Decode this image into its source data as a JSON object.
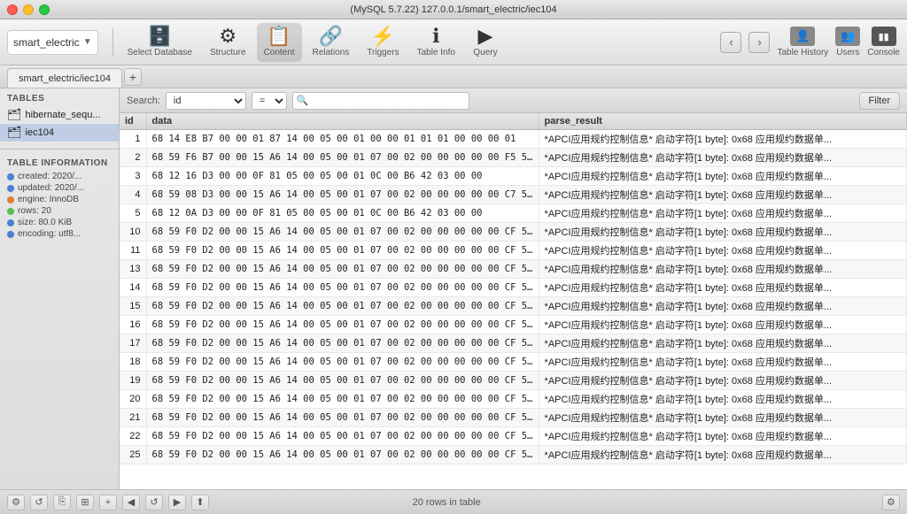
{
  "window": {
    "title": "(MySQL 5.7.22) 127.0.0.1/smart_electric/iec104"
  },
  "toolbar": {
    "db_selector": "smart_electric",
    "select_db_label": "Select Database",
    "structure_label": "Structure",
    "content_label": "Content",
    "relations_label": "Relations",
    "triggers_label": "Triggers",
    "tableinfo_label": "Table Info",
    "query_label": "Query",
    "table_history_label": "Table History",
    "users_label": "Users",
    "console_label": "Console"
  },
  "tabs": [
    {
      "label": "smart_electric/iec104",
      "active": true
    }
  ],
  "search": {
    "label": "Search:",
    "field_value": "id",
    "operator_value": "=",
    "placeholder": "",
    "filter_label": "Filter"
  },
  "sidebar": {
    "tables_title": "TABLES",
    "items": [
      {
        "label": "hibernate_sequ...",
        "active": false
      },
      {
        "label": "iec104",
        "active": true
      }
    ],
    "table_info_title": "TABLE INFORMATION",
    "info_rows": [
      {
        "label": "created: 2020/...",
        "color": "blue"
      },
      {
        "label": "updated: 2020/...",
        "color": "blue"
      },
      {
        "label": "engine: InnoDB",
        "color": "orange"
      },
      {
        "label": "rows: 20",
        "color": "green"
      },
      {
        "label": "size: 80.0 KiB",
        "color": "blue"
      },
      {
        "label": "encoding: utf8...",
        "color": "blue"
      }
    ]
  },
  "table": {
    "columns": [
      "id",
      "data",
      "parse_result"
    ],
    "rows": [
      {
        "id": "1",
        "data": "68 14 E8 B7 00 00 01 87 14 00 05 00 01 00 00 01 01 01 00 00 00 01",
        "parse_result": "*APCI应用规约控制信息* 启动字符[1 byte]: 0x68  应用规约数据单..."
      },
      {
        "id": "2",
        "data": "68 59 F6 B7 00 00 15 A6 14 00 05 00 01 07 00 02 00 00 00 00 00 F5 5C...",
        "parse_result": "*APCI应用规约控制信息* 启动字符[1 byte]: 0x68  应用规约数据单..."
      },
      {
        "id": "3",
        "data": "68 12 16 D3 00 00 0F 81 05 00 05 00 01 0C 00 B6 42 03 00 00",
        "parse_result": "*APCI应用规约控制信息* 启动字符[1 byte]: 0x68  应用规约数据单..."
      },
      {
        "id": "4",
        "data": "68 59 08 D3 00 00 15 A6 14 00 05 00 01 07 00 02 00 00 00 00 00 C7 5D...",
        "parse_result": "*APCI应用规约控制信息* 启动字符[1 byte]: 0x68  应用规约数据单..."
      },
      {
        "id": "5",
        "data": "68 12 0A D3 00 00 0F 81 05 00 05 00 01 0C 00 B6 42 03 00 00",
        "parse_result": "*APCI应用规约控制信息* 启动字符[1 byte]: 0x68  应用规约数据单..."
      },
      {
        "id": "10",
        "data": "68 59 F0 D2 00 00 15 A6 14 00 05 00 01 07 00 02 00 00 00 00 00 CF 5D...",
        "parse_result": "*APCI应用规约控制信息* 启动字符[1 byte]: 0x68  应用规约数据单..."
      },
      {
        "id": "11",
        "data": "68 59 F0 D2 00 00 15 A6 14 00 05 00 01 07 00 02 00 00 00 00 00 CF 5D...",
        "parse_result": "*APCI应用规约控制信息* 启动字符[1 byte]: 0x68  应用规约数据单..."
      },
      {
        "id": "13",
        "data": "68 59 F0 D2 00 00 15 A6 14 00 05 00 01 07 00 02 00 00 00 00 00 CF 5D...",
        "parse_result": "*APCI应用规约控制信息* 启动字符[1 byte]: 0x68  应用规约数据单..."
      },
      {
        "id": "14",
        "data": "68 59 F0 D2 00 00 15 A6 14 00 05 00 01 07 00 02 00 00 00 00 00 CF 5D...",
        "parse_result": "*APCI应用规约控制信息* 启动字符[1 byte]: 0x68  应用规约数据单..."
      },
      {
        "id": "15",
        "data": "68 59 F0 D2 00 00 15 A6 14 00 05 00 01 07 00 02 00 00 00 00 00 CF 5D...",
        "parse_result": "*APCI应用规约控制信息* 启动字符[1 byte]: 0x68  应用规约数据单..."
      },
      {
        "id": "16",
        "data": "68 59 F0 D2 00 00 15 A6 14 00 05 00 01 07 00 02 00 00 00 00 00 CF 5D...",
        "parse_result": "*APCI应用规约控制信息* 启动字符[1 byte]: 0x68  应用规约数据单..."
      },
      {
        "id": "17",
        "data": "68 59 F0 D2 00 00 15 A6 14 00 05 00 01 07 00 02 00 00 00 00 00 CF 5D...",
        "parse_result": "*APCI应用规约控制信息* 启动字符[1 byte]: 0x68  应用规约数据单..."
      },
      {
        "id": "18",
        "data": "68 59 F0 D2 00 00 15 A6 14 00 05 00 01 07 00 02 00 00 00 00 00 CF 5D...",
        "parse_result": "*APCI应用规约控制信息* 启动字符[1 byte]: 0x68  应用规约数据单..."
      },
      {
        "id": "19",
        "data": "68 59 F0 D2 00 00 15 A6 14 00 05 00 01 07 00 02 00 00 00 00 00 CF 5D...",
        "parse_result": "*APCI应用规约控制信息* 启动字符[1 byte]: 0x68  应用规约数据单..."
      },
      {
        "id": "20",
        "data": "68 59 F0 D2 00 00 15 A6 14 00 05 00 01 07 00 02 00 00 00 00 00 CF 5D...",
        "parse_result": "*APCI应用规约控制信息* 启动字符[1 byte]: 0x68  应用规约数据单..."
      },
      {
        "id": "21",
        "data": "68 59 F0 D2 00 00 15 A6 14 00 05 00 01 07 00 02 00 00 00 00 00 CF 5D...",
        "parse_result": "*APCI应用规约控制信息* 启动字符[1 byte]: 0x68  应用规约数据单..."
      },
      {
        "id": "22",
        "data": "68 59 F0 D2 00 00 15 A6 14 00 05 00 01 07 00 02 00 00 00 00 00 CF 5D...",
        "parse_result": "*APCI应用规约控制信息* 启动字符[1 byte]: 0x68  应用规约数据单..."
      },
      {
        "id": "25",
        "data": "68 59 F0 D2 00 00 15 A6 14 00 05 00 01 07 00 02 00 00 00 00 00 CF 5D...",
        "parse_result": "*APCI应用规约控制信息* 启动字符[1 byte]: 0x68  应用规约数据单..."
      }
    ]
  },
  "status_bar": {
    "rows_text": "20 rows in table",
    "add_label": "+",
    "remove_label": "−",
    "reload_label": "↺",
    "export_label": "↑"
  }
}
